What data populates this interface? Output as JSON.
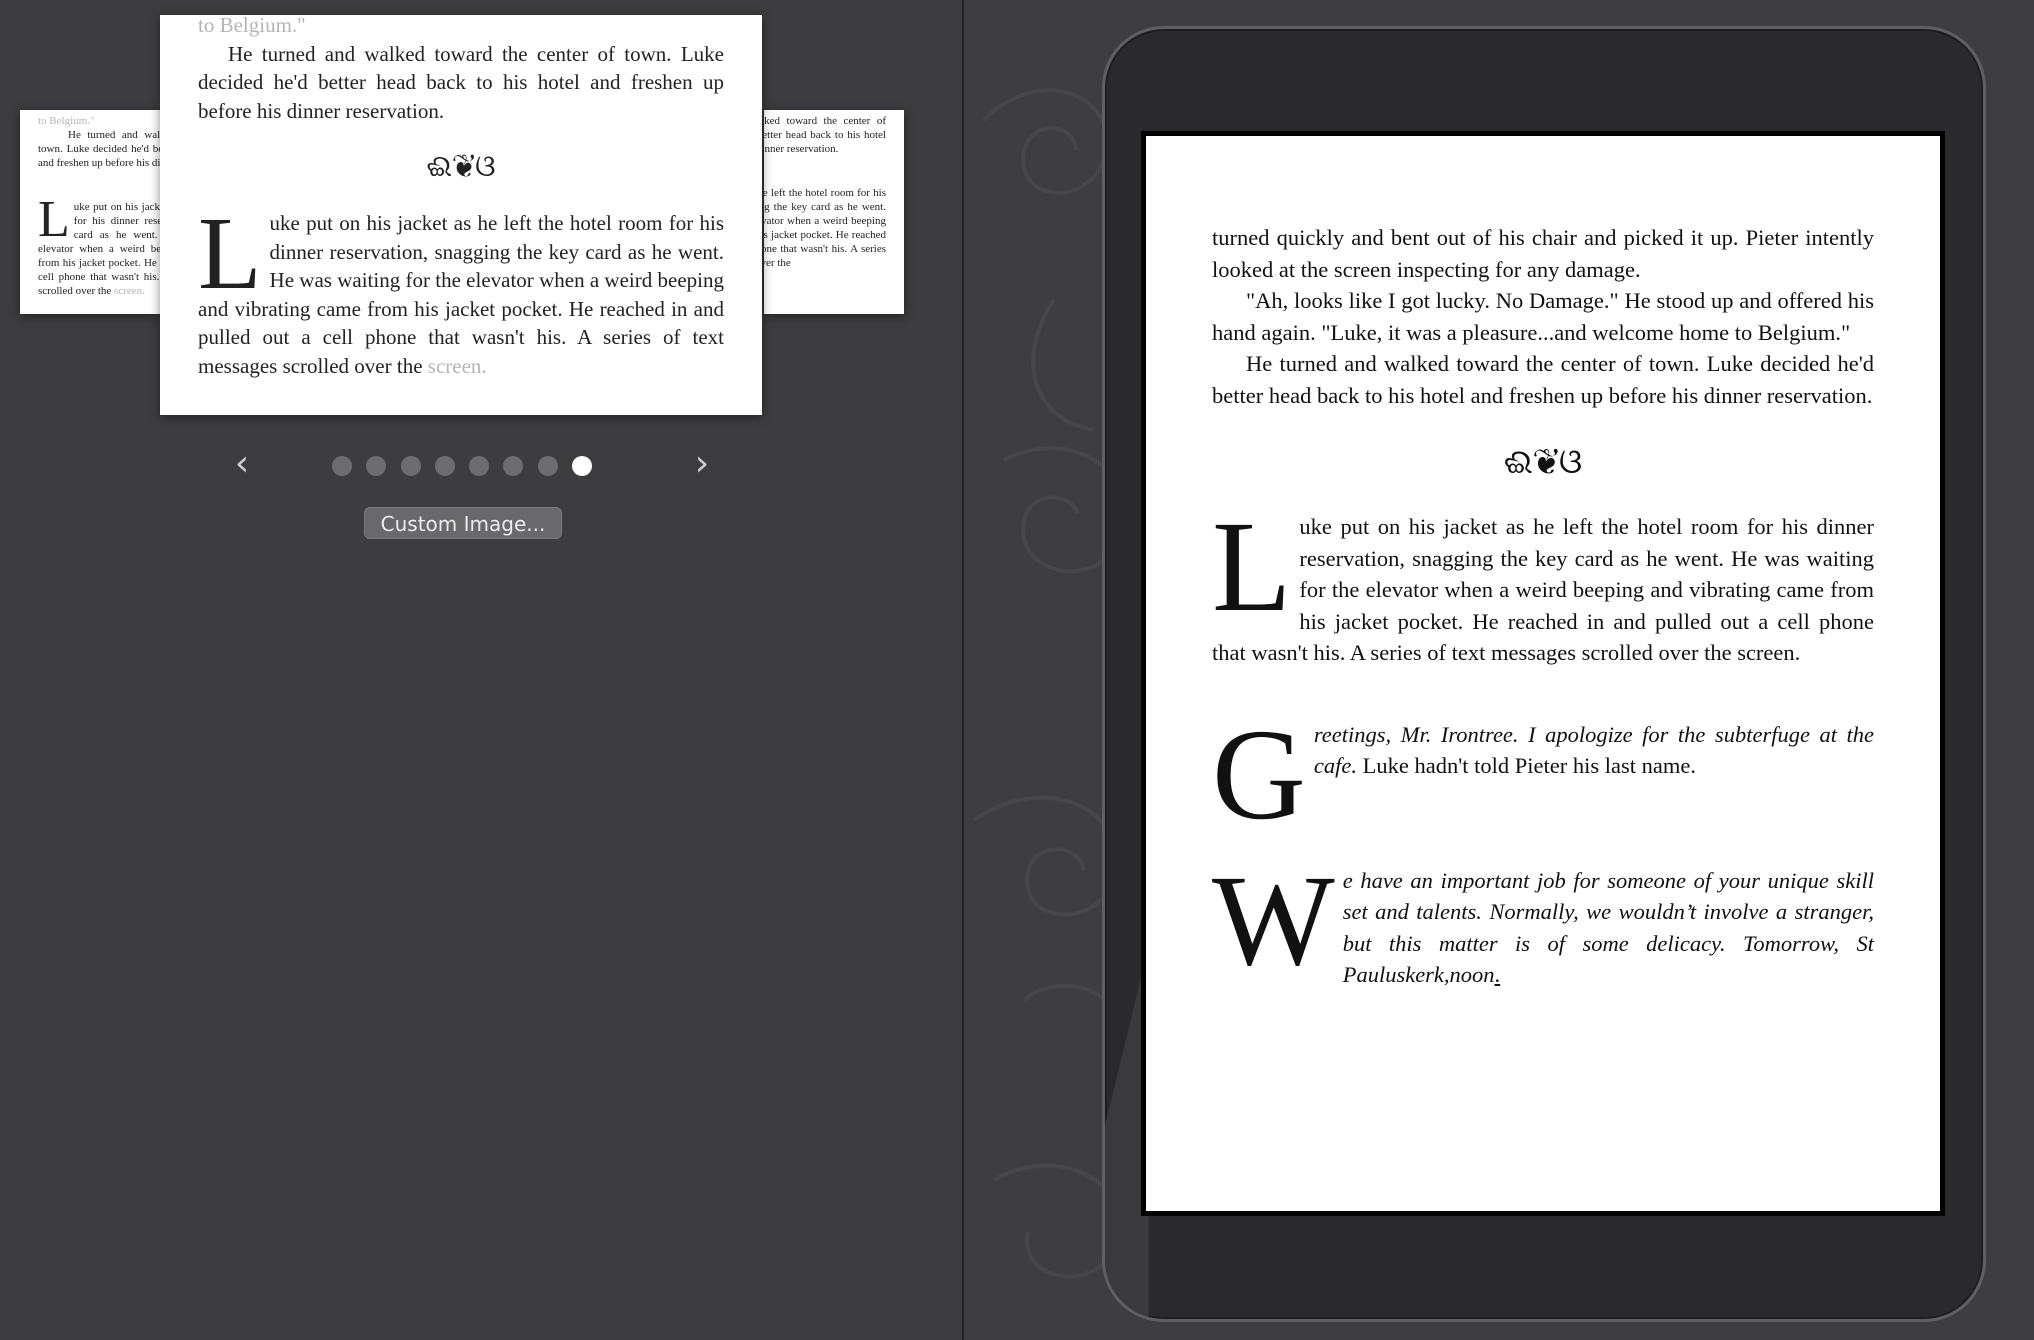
{
  "thumbnails": {
    "left_partial": {
      "faded": "to Belgium.\"",
      "para1": "He turned and walked toward the center of town. Luke decided he'd better head back to his hotel and freshen up before his dinner reservation.",
      "dropcap": "L",
      "para2": "uke put on his jacket as he left the hotel room for his dinner reservation, snagging the key card as he went. He was waiting for the elevator when a weird beeping and vibrating came from his jacket pocket. He reached in and pulled out a cell phone that wasn't his. A series of text messages scrolled over the",
      "faded_end": "screen."
    },
    "main": {
      "faded": "to Belgium.\"",
      "para1": "He turned and walked toward the center of town. Luke decided he'd better head back to his hotel and freshen up before his dinner reservation.",
      "ornament": "ଈ❦ଓ",
      "dropcap": "L",
      "para2": "uke put on his jacket as he left the hotel room for his dinner reservation, snagging the key card as he went. He was waiting for the elevator when a weird beeping and vibrating came from his jacket pocket. He reached in and pulled out a cell phone that wasn't his. A series of text messages scrolled over the",
      "faded_end": "screen."
    },
    "right_partial": {
      "para1": "He turned and walked toward the center of town. Luke decided he'd better head back to his hotel and freshen up before his dinner reservation.",
      "para2": "Luke put on his jacket as he left the hotel room for his dinner reservation, snagging the key card as he went. He was waiting for the elevator when a weird beeping and vibrating came from his jacket pocket. He reached in and pulled out a cell phone that wasn't his. A series of text messages scrolled over the"
    }
  },
  "navigation": {
    "prev_icon": "‹",
    "next_icon": "›",
    "dot_count": 8,
    "active_dot": 8
  },
  "custom_image_button": "Custom Image...",
  "device_screen": {
    "p1": "turned quickly and bent out of his chair and picked it up. Pieter intently looked at the screen inspecting for any damage.",
    "p2": "\"Ah, looks like I got lucky. No Damage.\" He stood up and offered his hand again. \"Luke, it was a pleasure...and welcome home to Belgium.\"",
    "p3": "He turned and walked toward the center of town. Luke decided he'd better head back to his hotel and freshen up before his dinner reservation.",
    "ornament": "ଈ❦ଓ",
    "drop1": "L",
    "p4": "uke put on his jacket as he left the hotel room for his dinner reservation, snagging the key card as he went. He was waiting for the elevator when a weird beeping and vibrating came from his jacket pocket. He reached in and pulled out a cell phone that wasn't his. A series of text messages scrolled over the screen.",
    "drop2": "G",
    "p5_italic": "reetings, Mr. Irontree. I apologize for the subterfuge at the cafe.",
    "p5_rest": "Luke hadn't told Pieter his last name.",
    "drop3": "W",
    "p6_italic": "e have an important job for someone of your unique skill set and talents. Normally, we wouldn’t involve a stranger, but this matter is of some delicacy. Tomorrow, St Pauluskerk,noon",
    "p6_end": "."
  }
}
